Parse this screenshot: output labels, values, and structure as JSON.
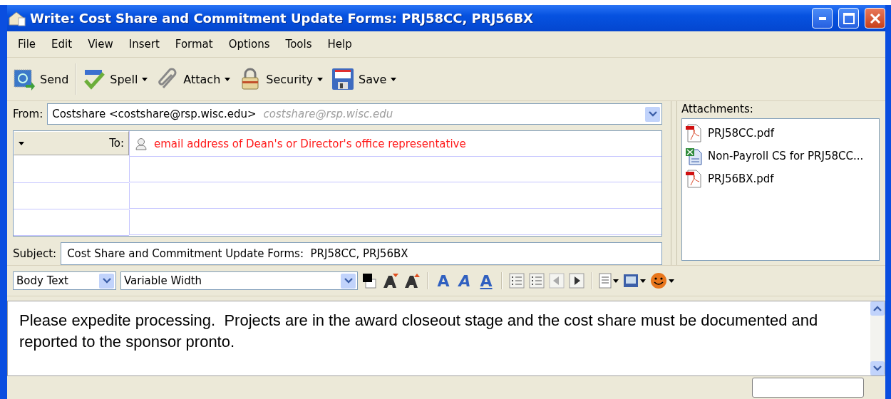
{
  "window": {
    "title": "Write: Cost Share and Commitment Update Forms: PRJ58CC, PRJ56BX"
  },
  "menu": [
    "File",
    "Edit",
    "View",
    "Insert",
    "Format",
    "Options",
    "Tools",
    "Help"
  ],
  "toolbar": [
    {
      "kind": "send",
      "label": "Send",
      "dropdown": false
    },
    {
      "kind": "spell",
      "label": "Spell",
      "dropdown": true
    },
    {
      "kind": "attach",
      "label": "Attach",
      "dropdown": true
    },
    {
      "kind": "security",
      "label": "Security",
      "dropdown": true
    },
    {
      "kind": "save",
      "label": "Save",
      "dropdown": true
    }
  ],
  "from": {
    "label": "From:",
    "value": "Costshare <costshare@rsp.wisc.edu>",
    "hint": "costshare@rsp.wisc.edu"
  },
  "recipients": [
    {
      "type": "To:",
      "address": "email address of Dean's or Director's office representative"
    }
  ],
  "subject": {
    "label": "Subject:",
    "value": "Cost Share and Commitment Update Forms:  PRJ58CC, PRJ56BX"
  },
  "attachments": {
    "label": "Attachments:",
    "items": [
      {
        "kind": "pdf",
        "name": "PRJ58CC.pdf"
      },
      {
        "kind": "spreadsheet",
        "name": "Non-Payroll CS for PRJ58CC..."
      },
      {
        "kind": "pdf",
        "name": "PRJ56BX.pdf"
      }
    ]
  },
  "format_bar": {
    "paragraph_style": "Body Text",
    "font": "Variable Width",
    "buttons": [
      {
        "kind": "color"
      },
      {
        "kind": "smaller"
      },
      {
        "kind": "larger"
      },
      {
        "kind": "sep"
      },
      {
        "kind": "bold",
        "glyph": "A"
      },
      {
        "kind": "italic",
        "glyph": "A"
      },
      {
        "kind": "underline",
        "glyph": "A"
      },
      {
        "kind": "sep"
      },
      {
        "kind": "bullets"
      },
      {
        "kind": "numbers"
      },
      {
        "kind": "outdent"
      },
      {
        "kind": "indent"
      },
      {
        "kind": "sep"
      },
      {
        "kind": "align"
      },
      {
        "kind": "image"
      },
      {
        "kind": "smiley"
      }
    ]
  },
  "body": {
    "text": "Please expedite processing.  Projects are in the award closeout stage and the cost share must be documented and reported to the sponsor pronto."
  }
}
